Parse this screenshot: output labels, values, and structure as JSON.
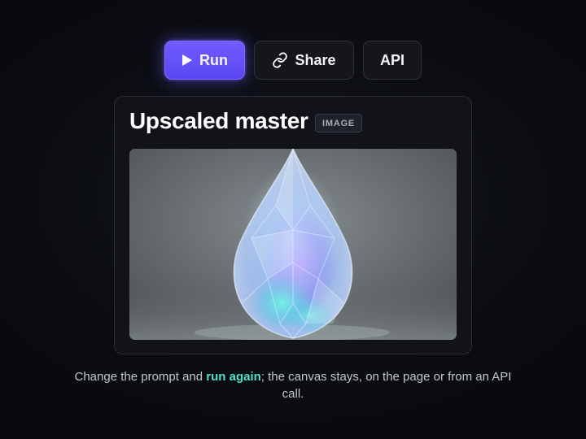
{
  "toolbar": {
    "run_label": "Run",
    "share_label": "Share",
    "api_label": "API",
    "accent": "#6a58fb"
  },
  "card": {
    "title": "Upscaled master",
    "badge": "IMAGE",
    "image_subject": "glowing crystal droplet"
  },
  "caption": {
    "before": "Change the prompt and ",
    "highlight": "run again",
    "after": "; the canvas stays, on the page or from an API call.",
    "highlight_color": "#4fe0c6"
  },
  "icons": {
    "run": "play-icon",
    "share": "link-icon"
  }
}
